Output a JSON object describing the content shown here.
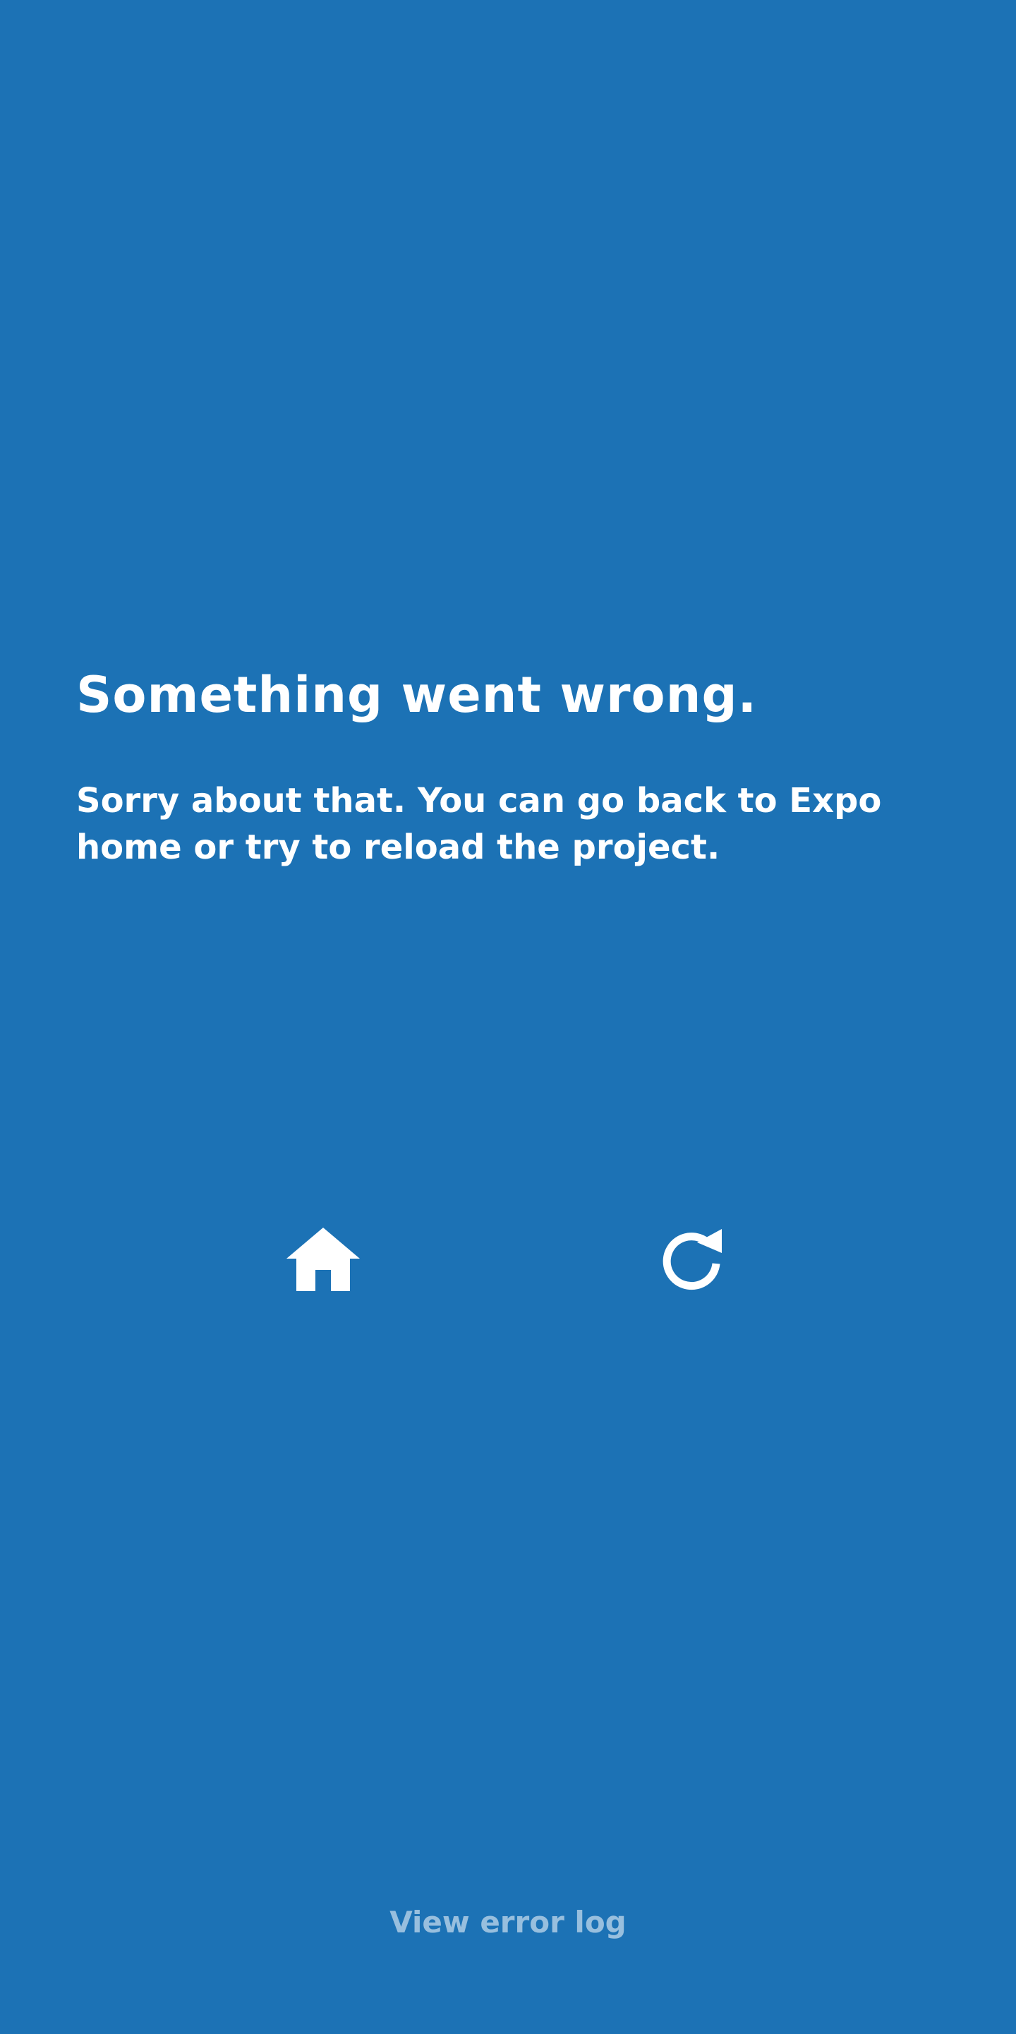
{
  "error": {
    "title": "Something went wrong.",
    "message": "Sorry about that. You can go back to Expo home or try to reload the project."
  },
  "actions": {
    "home_icon": "home-icon",
    "reload_icon": "reload-icon"
  },
  "footer": {
    "view_error_log": "View error log"
  },
  "colors": {
    "background": "#1c72b5",
    "text": "#ffffff",
    "muted_text": "rgba(255,255,255,0.55)"
  }
}
